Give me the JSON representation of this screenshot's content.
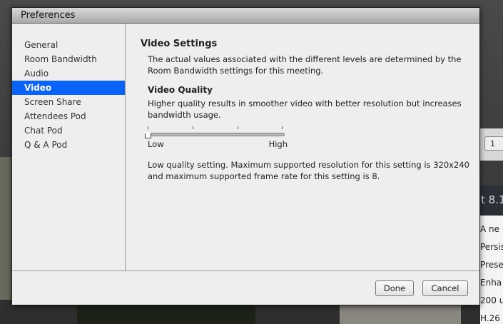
{
  "dialog": {
    "title": "Preferences"
  },
  "sidebar": {
    "items": [
      {
        "label": "General"
      },
      {
        "label": "Room Bandwidth"
      },
      {
        "label": "Audio"
      },
      {
        "label": "Video",
        "active": true
      },
      {
        "label": "Screen Share"
      },
      {
        "label": "Attendees Pod"
      },
      {
        "label": "Chat Pod"
      },
      {
        "label": "Q & A Pod"
      }
    ]
  },
  "content": {
    "title": "Video Settings",
    "intro": "The actual values associated with the different levels are determined by the Room Bandwidth settings for this meeting.",
    "quality_heading": "Video Quality",
    "quality_desc": "Higher quality results in smoother video with better resolution but increases bandwidth usage.",
    "slider": {
      "min_label": "Low",
      "max_label": "High",
      "value": 0,
      "levels": 4
    },
    "setting_info": "Low quality setting. Maximum supported resolution for this setting is 320x240 and maximum supported frame rate for this setting is 8."
  },
  "footer": {
    "done_label": "Done",
    "cancel_label": "Cancel"
  },
  "background": {
    "page_button": "1",
    "heading_fragment": "t 8.1",
    "notes": [
      "A ne",
      "Persis",
      "Prese",
      "Enha",
      "200 u",
      "H.26"
    ]
  }
}
